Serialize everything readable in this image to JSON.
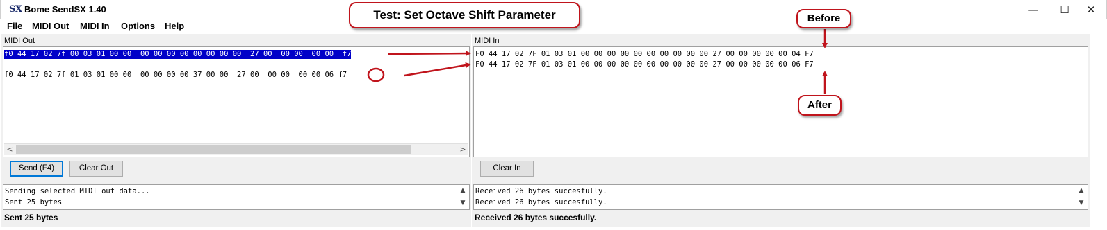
{
  "window": {
    "icon_text": "SX",
    "title": "Bome SendSX 1.40",
    "minimize": "—",
    "maximize": "☐",
    "close": "✕"
  },
  "menu": [
    "File",
    "MIDI Out",
    "MIDI In",
    "Options",
    "Help"
  ],
  "midi_out": {
    "label": "MIDI Out",
    "lines": [
      "f0 44 17 02 7f 00 03 01 00 00  00 00 00 00 00 00 00 00  27 00  00 00  00 00  f7",
      "f0 44 17 02 7f 01 03 01 00 00  00 00 00 00 37 00 00  27 00  00 00  00 00 "
    ],
    "line2_highlight": "06",
    "line2_end": " f7",
    "send_button": "Send (F4)",
    "clear_button": "Clear Out",
    "log": [
      "Sending selected MIDI out data...",
      "Sent 25 bytes"
    ],
    "status": "Sent 25 bytes"
  },
  "midi_in": {
    "label": "MIDI In",
    "lines": [
      "F0 44 17 02 7F 01 03 01 00 00 00 00 00 00 00 00 00 00 27 00 00 00 00 00 04 F7",
      "F0 44 17 02 7F 01 03 01 00 00 00 00 00 00 00 00 00 00 27 00 00 00 00 00 06 F7"
    ],
    "clear_button": "Clear In",
    "log": [
      "Received 26 bytes succesfully.",
      "Received 26 bytes succesfully."
    ],
    "status": "Received 26 bytes succesfully."
  },
  "annotations": {
    "title": "Test: Set Octave Shift Parameter",
    "before": "Before",
    "after": "After",
    "color": "#c0141c"
  },
  "colors": {
    "selection": "#0000c8",
    "accent": "#0078d7"
  }
}
